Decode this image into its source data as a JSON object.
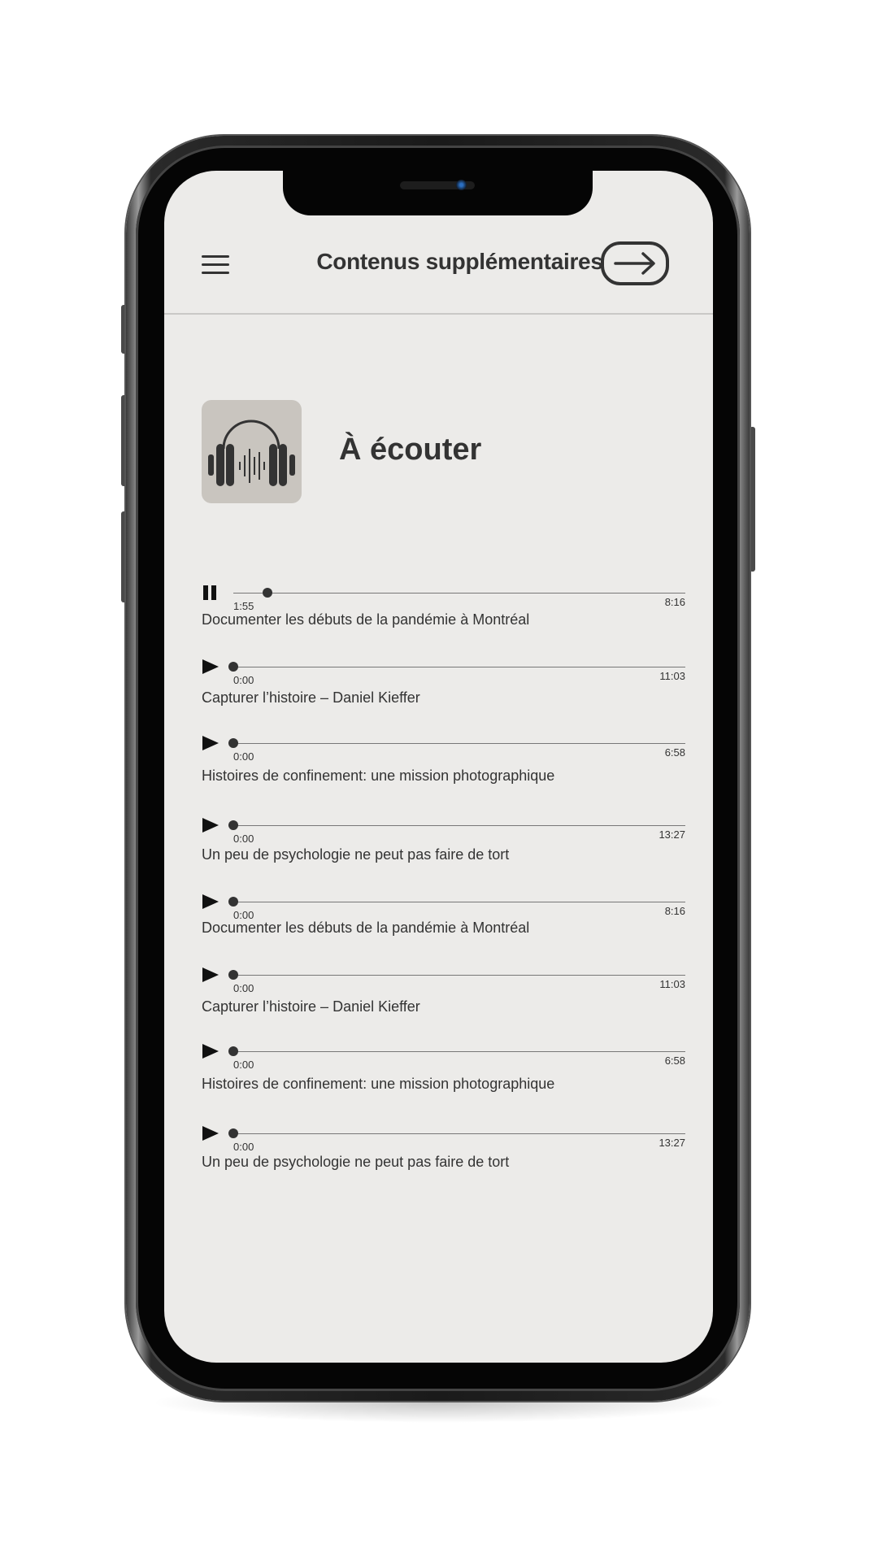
{
  "header": {
    "title": "Contenus supplémentaires",
    "menu_icon": "hamburger-menu-icon",
    "exit_icon": "arrow-right-icon"
  },
  "section": {
    "title": "À écouter",
    "icon": "headphones-icon"
  },
  "colors": {
    "screen_background": "#ecebe9",
    "icon_tile": "#c9c5bf",
    "text": "#333333"
  },
  "tracks": [
    {
      "title": "Documenter les débuts de la pandémie à Montréal",
      "current_time": "1:55",
      "duration": "8:16",
      "state": "playing",
      "progress": 0.075
    },
    {
      "title": "Capturer l’histoire – Daniel Kieffer",
      "current_time": "0:00",
      "duration": "11:03",
      "state": "paused",
      "progress": 0
    },
    {
      "title": "Histoires de confinement: une mission photographique",
      "current_time": "0:00",
      "duration": "6:58",
      "state": "paused",
      "progress": 0
    },
    {
      "title": "Un peu de psychologie ne peut pas faire de tort",
      "current_time": "0:00",
      "duration": "13:27",
      "state": "paused",
      "progress": 0
    },
    {
      "title": "Documenter les débuts de la pandémie à Montréal",
      "current_time": "0:00",
      "duration": "8:16",
      "state": "paused",
      "progress": 0
    },
    {
      "title": "Capturer l’histoire – Daniel Kieffer",
      "current_time": "0:00",
      "duration": "11:03",
      "state": "paused",
      "progress": 0
    },
    {
      "title": "Histoires de confinement: une mission photographique",
      "current_time": "0:00",
      "duration": "6:58",
      "state": "paused",
      "progress": 0
    },
    {
      "title": "Un peu de psychologie ne peut pas faire de tort",
      "current_time": "0:00",
      "duration": "13:27",
      "state": "paused",
      "progress": 0
    }
  ]
}
